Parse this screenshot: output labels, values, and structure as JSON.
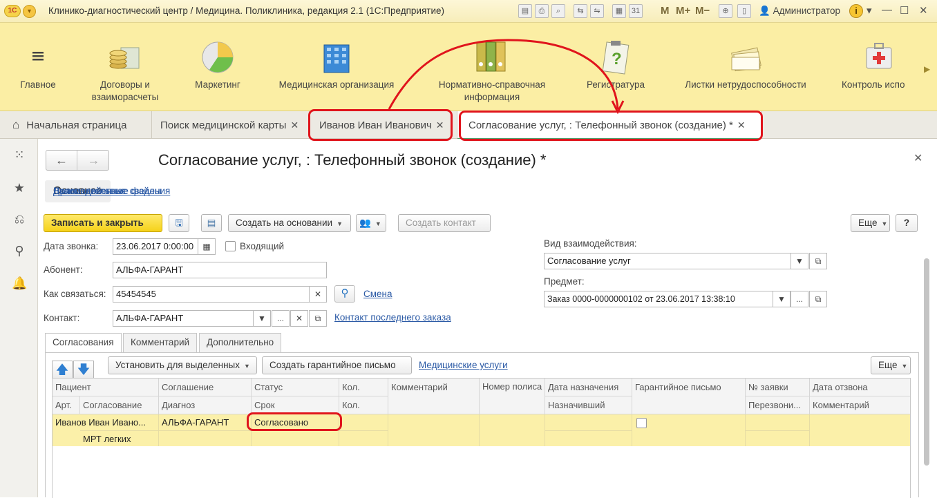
{
  "window": {
    "title": "Клинико-диагностический центр / Медицина. Поликлиника, редакция 2.1  (1С:Предприятие)",
    "user": "Администратор",
    "m_buttons": [
      "M",
      "M+",
      "M−"
    ],
    "logo_text": "1С"
  },
  "sections": [
    {
      "label": "Главное",
      "icon": "menu-lines-icon"
    },
    {
      "label": "Договоры и\nвзаиморасчеты",
      "icon": "coins-icon"
    },
    {
      "label": "Маркетинг",
      "icon": "pie-chart-icon"
    },
    {
      "label": "Медицинская организация",
      "icon": "building-icon"
    },
    {
      "label": "Нормативно-справочная\nинформация",
      "icon": "binders-icon"
    },
    {
      "label": "Регистратура",
      "icon": "clipboard-question-icon"
    },
    {
      "label": "Листки нетрудоспособности",
      "icon": "sheets-icon"
    },
    {
      "label": "Контроль испо",
      "icon": "first-aid-icon"
    }
  ],
  "tabs": [
    {
      "label": "Начальная страница",
      "closable": false
    },
    {
      "label": "Поиск медицинской карты",
      "closable": true
    },
    {
      "label": "Иванов Иван Иванович",
      "closable": true
    },
    {
      "label": "Согласование услуг, : Телефонный звонок (создание) *",
      "closable": true,
      "active": true
    }
  ],
  "form": {
    "title": "Согласование услуг, : Телефонный звонок (создание) *",
    "tabs": [
      "Основное",
      "Взаимодействия",
      "Присоединенные файлы",
      "Дополнительные сведения"
    ],
    "toolbar": {
      "save_close": "Записать и закрыть",
      "create_basis": "Создать на основании",
      "create_contact": "Создать контакт",
      "more": "Еще",
      "help": "?"
    },
    "call_date_label": "Дата звонка:",
    "call_date_value": "23.06.2017  0:00:00",
    "incoming_label": "Входящий",
    "subscriber_label": "Абонент:",
    "subscriber_value": "АЛЬФА-ГАРАНТ",
    "how_contact_label": "Как связаться:",
    "how_contact_value": "45454545",
    "change_link": "Смена",
    "contact_label": "Контакт:",
    "contact_value": "АЛЬФА-ГАРАНТ",
    "last_order_contact_link": "Контакт последнего заказа",
    "interaction_type_label": "Вид взаимодействия:",
    "interaction_type_value": "Согласование услуг",
    "subject_label": "Предмет:",
    "subject_value": "Заказ 0000-0000000102 от 23.06.2017 13:38:10",
    "inner_tabs": [
      "Согласования",
      "Комментарий",
      "Дополнительно"
    ],
    "inner_toolbar": {
      "set_for_selected": "Установить для выделенных",
      "create_guarantee": "Создать гарантийное письмо",
      "medical_services": "Медицинские услуги",
      "more": "Еще"
    },
    "grid": {
      "header_row1": [
        "Пациент",
        "Соглашение",
        "Статус",
        "Кол.",
        "Комментарий",
        "Номер полиса",
        "Дата назначения",
        "Гарантийное письмо",
        "№ заявки",
        "Дата отзвона"
      ],
      "header_row2": [
        "Арт.",
        "Согласование",
        "Диагноз",
        "Срок",
        "Кол.",
        "Назначивший",
        "Перезвони...",
        "Комментарий"
      ],
      "rows": [
        {
          "patient": "Иванов Иван Ивано...",
          "agreement": "АЛЬФА-ГАРАНТ",
          "status": "Согласовано",
          "service": "МРТ легких"
        }
      ]
    }
  }
}
